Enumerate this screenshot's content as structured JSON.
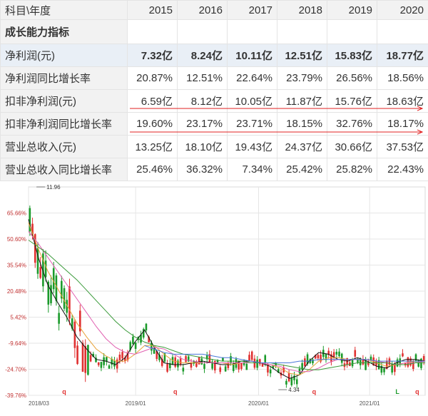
{
  "table": {
    "corner_label": "科目\\年度",
    "years": [
      "2015",
      "2016",
      "2017",
      "2018",
      "2019",
      "2020"
    ],
    "section_label": "成长能力指标",
    "rows": [
      {
        "label": "净利润(元)",
        "values": [
          "7.32亿",
          "8.24亿",
          "10.11亿",
          "12.51亿",
          "15.83亿",
          "18.77亿"
        ],
        "bold": true,
        "highlight": true
      },
      {
        "label": "净利润同比增长率",
        "values": [
          "20.87%",
          "12.51%",
          "22.64%",
          "23.79%",
          "26.56%",
          "18.56%"
        ]
      },
      {
        "label": "扣非净利润(元)",
        "values": [
          "6.59亿",
          "8.12亿",
          "10.05亿",
          "11.87亿",
          "15.76亿",
          "18.63亿"
        ]
      },
      {
        "label": "扣非净利润同比增长率",
        "values": [
          "19.60%",
          "23.17%",
          "23.71%",
          "18.15%",
          "32.76%",
          "18.17%"
        ]
      },
      {
        "label": "营业总收入(元)",
        "values": [
          "13.25亿",
          "18.10亿",
          "19.43亿",
          "24.37亿",
          "30.66亿",
          "37.53亿"
        ]
      },
      {
        "label": "营业总收入同比增长率",
        "values": [
          "25.46%",
          "36.32%",
          "7.34%",
          "25.42%",
          "25.82%",
          "22.43%"
        ]
      }
    ],
    "annotation_color": "#e02020"
  },
  "chart_data": {
    "type": "line",
    "y_ticks": [
      "65.66%",
      "50.60%",
      "35.54%",
      "20.48%",
      "5.42%",
      "-9.64%",
      "-24.70%",
      "-39.76%"
    ],
    "y_values": [
      65.66,
      50.6,
      35.54,
      20.48,
      5.42,
      -9.64,
      -24.7,
      -39.76
    ],
    "ylim": [
      -39.76,
      80.72
    ],
    "x_ticks": [
      "2018/03",
      "2019/01",
      "2020/01",
      "2021/01"
    ],
    "x_tick_positions": [
      0,
      0.27,
      0.58,
      0.86
    ],
    "annotations": [
      {
        "text": "11.96",
        "x": 0.02,
        "y": 80.72,
        "kind": "high"
      },
      {
        "text": "4.34",
        "x": 0.63,
        "y": -36.5,
        "kind": "low"
      }
    ],
    "markers": [
      {
        "text": "q",
        "x": 0.09
      },
      {
        "text": "q",
        "x": 0.37
      },
      {
        "text": "q",
        "x": 0.72
      },
      {
        "text": "L",
        "x": 0.93
      },
      {
        "text": "q",
        "x": 0.98
      }
    ],
    "series": [
      {
        "kind": "ma",
        "color": "#111111",
        "values": [
          62,
          40,
          24,
          14,
          5,
          -6,
          -13,
          -19,
          -20,
          -22,
          -18,
          -9,
          -2,
          -12,
          -21,
          -22,
          -22,
          -21,
          -20,
          -21,
          -22,
          -22,
          -20,
          -20,
          -21,
          -23,
          -27,
          -30,
          -28,
          -20,
          -15,
          -16,
          -19,
          -20,
          -18,
          -20,
          -23,
          -24,
          -21,
          -19,
          -19,
          -20
        ]
      },
      {
        "kind": "ma",
        "color": "#e8a33a",
        "values": [
          60,
          45,
          32,
          22,
          12,
          2,
          -6,
          -13,
          -17,
          -20,
          -20,
          -16,
          -11,
          -11,
          -16,
          -20,
          -21,
          -21,
          -21,
          -21,
          -21,
          -22,
          -21,
          -21,
          -21,
          -22,
          -24,
          -27,
          -28,
          -25,
          -20,
          -18,
          -18,
          -19,
          -19,
          -19,
          -21,
          -23,
          -22,
          -21,
          -20,
          -20
        ]
      },
      {
        "kind": "ma",
        "color": "#e060b0",
        "values": [
          55,
          48,
          40,
          32,
          24,
          16,
          8,
          0,
          -7,
          -12,
          -15,
          -16,
          -14,
          -12,
          -13,
          -16,
          -19,
          -20,
          -21,
          -21,
          -21,
          -21,
          -21,
          -21,
          -21,
          -22,
          -23,
          -25,
          -26,
          -26,
          -24,
          -21,
          -19,
          -19,
          -19,
          -19,
          -20,
          -21,
          -22,
          -21,
          -21,
          -20
        ]
      },
      {
        "kind": "ma",
        "color": "#3a9a3a",
        "values": [
          50,
          46,
          42,
          37,
          32,
          27,
          21,
          15,
          9,
          3,
          -2,
          -6,
          -9,
          -11,
          -12,
          -14,
          -16,
          -17,
          -18,
          -19,
          -20,
          -20,
          -20,
          -21,
          -21,
          -21,
          -22,
          -23,
          -24,
          -25,
          -25,
          -24,
          -23,
          -22,
          -21,
          -21,
          -21,
          -21,
          -22,
          -22,
          -21,
          -21
        ]
      },
      {
        "kind": "ma",
        "color": "#4a78d8",
        "values": [
          0,
          0,
          0,
          0,
          0,
          0,
          0,
          0,
          0,
          0,
          0,
          0,
          -11,
          -13,
          -15,
          -16,
          -16,
          -16,
          -16,
          -17,
          -18,
          -18,
          -19,
          -20,
          -21,
          -21,
          -21,
          -21,
          -20,
          -20,
          -19,
          -19,
          -19,
          -19,
          -19,
          -19,
          -20,
          -20,
          -20,
          -20,
          -20,
          -20
        ]
      }
    ]
  }
}
